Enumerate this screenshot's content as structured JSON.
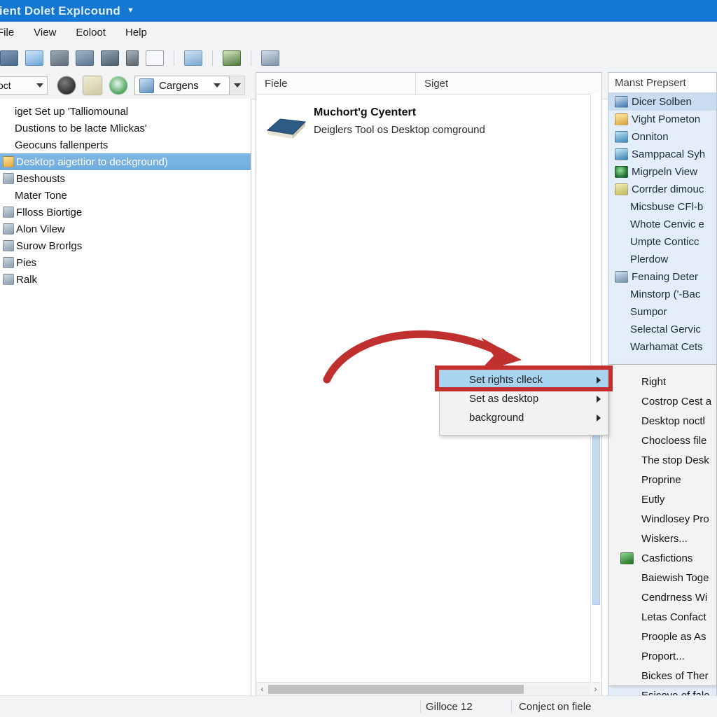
{
  "window": {
    "title": "lient Dolet Explcound",
    "title_caret": "▼"
  },
  "menubar": {
    "items": [
      {
        "label": "File",
        "mnemonic": "F"
      },
      {
        "label": "View",
        "mnemonic": "V"
      },
      {
        "label": "Eoloot",
        "mnemonic": "E"
      },
      {
        "label": "Help",
        "mnemonic": "H"
      }
    ]
  },
  "toolbar": {
    "icons": [
      "open-folder-icon",
      "import-icon",
      "print-icon",
      "save-icon",
      "camera-icon",
      "chart-icon",
      "comment-icon",
      "card-icon",
      "picture-icon",
      "refresh-icon"
    ],
    "left_combo": {
      "value": "oct",
      "caret": "▼"
    },
    "round_buttons": [
      "tree-icon",
      "note-icon",
      "record-icon"
    ],
    "main_combo": {
      "icon": "document-icon",
      "value": "Cargens",
      "caret": "▼"
    },
    "overflow_caret": "▼"
  },
  "left_tree": {
    "items": [
      {
        "label": "iget Set up 'Talliomounal",
        "icon": "none",
        "selected": false
      },
      {
        "label": "Dustions to be lacte Mlickas'",
        "icon": "none",
        "selected": false
      },
      {
        "label": "Geocuns fallenperts",
        "icon": "none",
        "selected": false
      },
      {
        "label": "Desktop aigettior to deckground)",
        "icon": "folder-icon",
        "selected": true
      },
      {
        "label": "Beshousts",
        "icon": "item-icon",
        "selected": false
      },
      {
        "label": "Mater Tone",
        "icon": "none",
        "selected": false
      },
      {
        "label": "Flloss Biortige",
        "icon": "item-icon",
        "selected": false
      },
      {
        "label": "Alon Vilew",
        "icon": "item-icon",
        "selected": false
      },
      {
        "label": "Surow Brorlgs",
        "icon": "item-icon",
        "selected": false
      },
      {
        "label": "Pies",
        "icon": "item-icon",
        "selected": false
      },
      {
        "label": "Ralk",
        "icon": "item-icon",
        "selected": false
      }
    ]
  },
  "center_panel": {
    "columns": [
      "Fiele",
      "Siget"
    ],
    "file_item": {
      "icon": "book-icon",
      "title": "Muchort'g Cyentert",
      "subtitle": "Deiglers Tool os Desktop comground"
    },
    "scroll": {
      "left_arrow": "‹",
      "right_arrow": "›"
    }
  },
  "right_panel": {
    "header": "Manst Prepsert",
    "items": [
      {
        "label": "Dicer Solben",
        "icon": "properties-icon",
        "selected": true
      },
      {
        "label": "Vight Pometon",
        "icon": "folder-yellow-icon",
        "selected": false
      },
      {
        "label": "Onniton",
        "icon": "upload-icon",
        "selected": false
      },
      {
        "label": "Samppacal Syh",
        "icon": "pen-icon",
        "selected": false
      },
      {
        "label": "Migrpeln View",
        "icon": "globe-icon",
        "selected": false
      },
      {
        "label": "Corrder dimouc",
        "icon": "image-icon",
        "selected": false
      },
      {
        "label": "Micsbuse CFl-b",
        "icon": "none",
        "selected": false
      },
      {
        "label": "Whote Cenvic e",
        "icon": "none",
        "selected": false
      },
      {
        "label": "Umpte Conticc",
        "icon": "none",
        "selected": false
      },
      {
        "label": "Plerdow",
        "icon": "none",
        "selected": false
      },
      {
        "label": "Fenaing Deter",
        "icon": "lock-icon",
        "selected": false
      },
      {
        "label": "Minstorp ('-Bac",
        "icon": "none",
        "selected": false
      },
      {
        "label": "Sumpor",
        "icon": "none",
        "selected": false
      },
      {
        "label": "Selectal Gervic",
        "icon": "none",
        "selected": false
      },
      {
        "label": "Warhamat Cets",
        "icon": "none",
        "selected": false
      }
    ]
  },
  "submenu": {
    "items": [
      {
        "label": "Right",
        "icon": "none"
      },
      {
        "label": "Costrop Cest a",
        "icon": "none"
      },
      {
        "label": "Desktop noctl",
        "icon": "none"
      },
      {
        "label": "Chocloess file",
        "icon": "none"
      },
      {
        "label": "The stop Desk",
        "icon": "none"
      },
      {
        "label": "Proprine",
        "icon": "none"
      },
      {
        "label": "Eutly",
        "icon": "none"
      },
      {
        "label": "Windlosey Pro",
        "icon": "none"
      },
      {
        "label": "Wiskers...",
        "icon": "none"
      },
      {
        "label": "Casfictions",
        "icon": "green-square-icon"
      },
      {
        "label": "Baiewish Toge",
        "icon": "none"
      },
      {
        "label": "Cendrness Wi",
        "icon": "none"
      },
      {
        "label": "Letas Confact",
        "icon": "none"
      },
      {
        "label": "Proople as As",
        "icon": "none"
      },
      {
        "label": "Proport...",
        "icon": "none"
      },
      {
        "label": "Bickes of Ther",
        "icon": "none"
      },
      {
        "label": "Esicove of fale",
        "icon": "none"
      }
    ]
  },
  "context_menu": {
    "items": [
      {
        "label": "Set rights clleck",
        "highlighted": true,
        "arrow": "▶"
      },
      {
        "label": "Set as desktop",
        "highlighted": false,
        "arrow": "▶"
      },
      {
        "label": "background",
        "highlighted": false,
        "arrow": "▶"
      }
    ]
  },
  "annotation": {
    "arrow_color": "#c62f2f",
    "highlight_box_color": "#c62f2f"
  },
  "statusbar": {
    "left_text": "Gilloce 12",
    "right_text": "Conject on fiele"
  },
  "colors": {
    "title_blue": "#1477d1",
    "selection_blue": "#77b2e2",
    "right_panel_bg": "#e3eefa",
    "menu_highlight": "#a8d4f2"
  }
}
